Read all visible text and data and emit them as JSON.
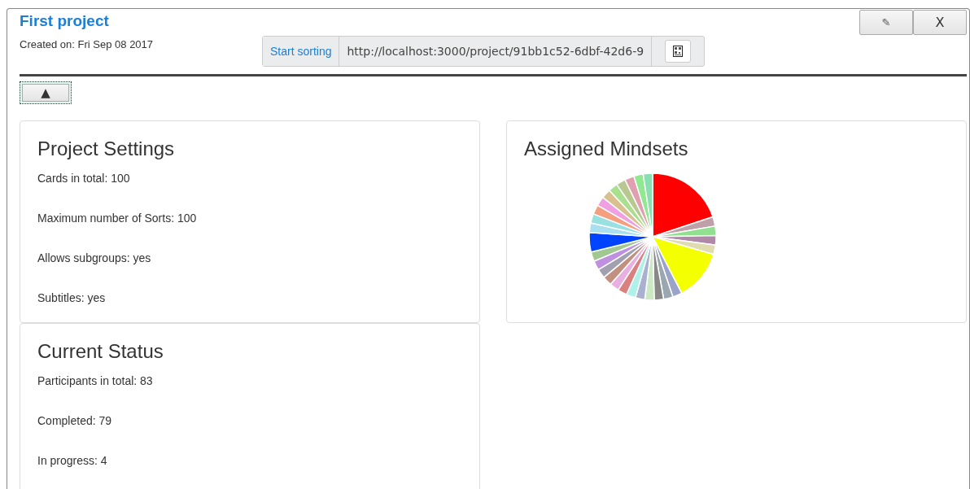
{
  "project": {
    "title": "First project",
    "created": "Created on: Fri Sep 08 2017"
  },
  "header_buttons": [
    {
      "kind": "edit",
      "label": "✎"
    },
    {
      "kind": "close",
      "label": "X"
    }
  ],
  "share": {
    "button": "Start sorting",
    "url": "http://localhost:3000/project/91bb1c52-6dbf-42d6-9"
  },
  "collapse_button": {
    "label": "▲",
    "focused": true
  },
  "settings": {
    "title": "Project Settings",
    "lines": [
      "Cards in total: 100",
      "Maximum number of Sorts: 100",
      "Allows subgroups: yes",
      "Subtitles: yes"
    ]
  },
  "mindsets": {
    "title": "Assigned Mindsets",
    "kind": "picture"
  },
  "status": {
    "title": "Current Status",
    "lines": [
      "Participants in total: 83",
      "Completed: 79",
      "In progress: 4"
    ]
  }
}
